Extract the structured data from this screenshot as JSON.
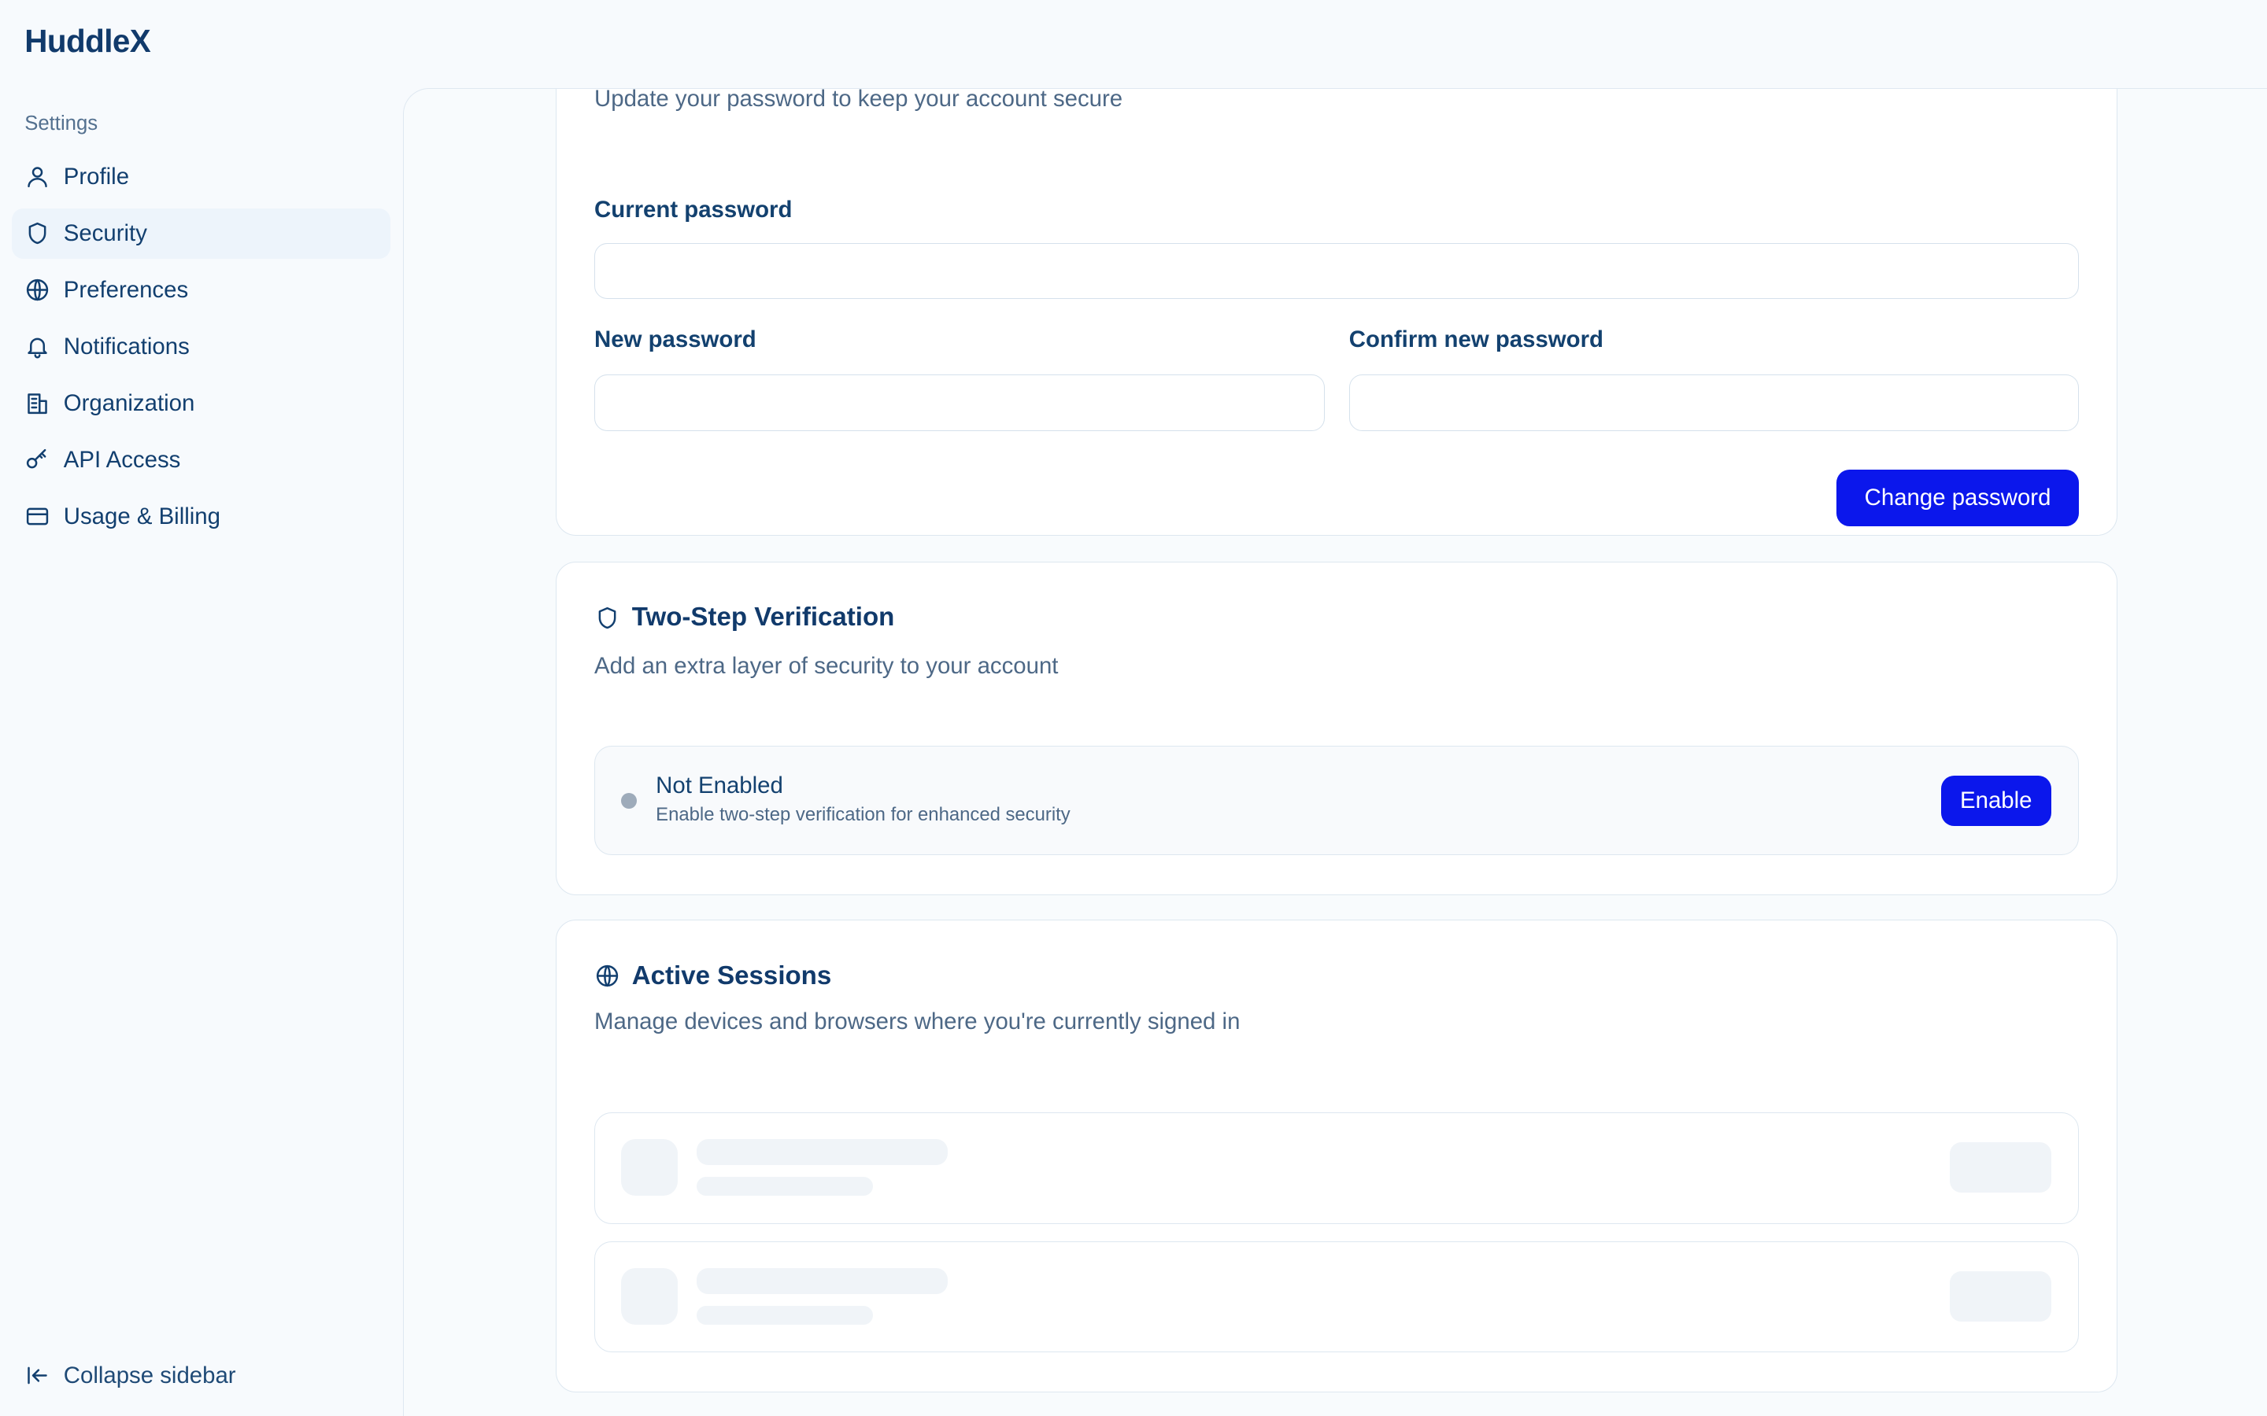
{
  "app": {
    "brand": "HuddleX"
  },
  "sidebar": {
    "section_label": "Settings",
    "items": [
      {
        "label": "Profile",
        "icon": "user-icon",
        "active": false
      },
      {
        "label": "Security",
        "icon": "shield-icon",
        "active": true
      },
      {
        "label": "Preferences",
        "icon": "globe-icon",
        "active": false
      },
      {
        "label": "Notifications",
        "icon": "bell-icon",
        "active": false
      },
      {
        "label": "Organization",
        "icon": "building-icon",
        "active": false
      },
      {
        "label": "API Access",
        "icon": "key-icon",
        "active": false
      },
      {
        "label": "Usage & Billing",
        "icon": "credit-card-icon",
        "active": false
      }
    ],
    "collapse_label": "Collapse sidebar"
  },
  "password_card": {
    "subtitle": "Update your password to keep your account secure",
    "current_label": "Current password",
    "current_value": "",
    "new_label": "New password",
    "new_value": "",
    "confirm_label": "Confirm new password",
    "confirm_value": "",
    "submit_label": "Change password"
  },
  "two_step": {
    "title": "Two-Step Verification",
    "subtitle": "Add an extra layer of security to your account",
    "status_title": "Not Enabled",
    "status_desc": "Enable two-step verification for enhanced security",
    "enable_label": "Enable"
  },
  "sessions": {
    "title": "Active Sessions",
    "subtitle": "Manage devices and browsers where you're currently signed in"
  },
  "colors": {
    "accent": "#0b17ec",
    "text_primary": "#113a6b",
    "text_secondary": "#4d6886",
    "status_dot": "#9eabba"
  }
}
